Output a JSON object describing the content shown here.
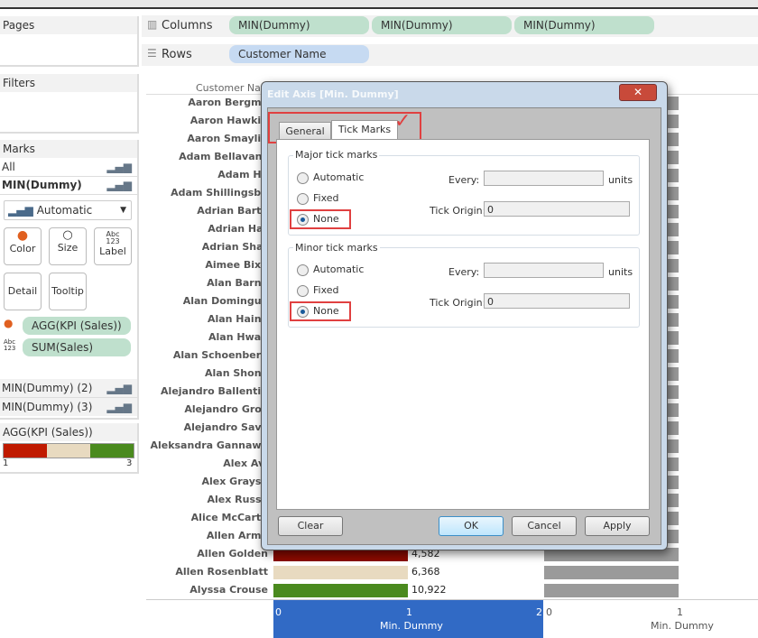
{
  "left_panel": {
    "pages": "Pages",
    "filters": "Filters",
    "marks": "Marks",
    "all": "All",
    "min_dummy": "MIN(Dummy)",
    "mark_type": "Automatic",
    "cards": [
      "Color",
      "Size",
      "Label",
      "Detail",
      "Tooltip"
    ],
    "label_icon_text": "Abc 123",
    "fields": [
      "AGG(KPI (Sales))",
      "SUM(Sales)"
    ],
    "min_dummy_2": "MIN(Dummy) (2)",
    "min_dummy_3": "MIN(Dummy) (3)",
    "legend": {
      "title": "AGG(KPI (Sales))",
      "min": "1",
      "max": "3",
      "colors": [
        "#c01a00",
        "#e8dac0",
        "#4a8a1e"
      ]
    }
  },
  "shelves": {
    "columns_label": "Columns",
    "columns": [
      "MIN(Dummy)",
      "MIN(Dummy)",
      "MIN(Dummy)"
    ],
    "rows_label": "Rows",
    "rows": [
      "Customer Name"
    ]
  },
  "view": {
    "header": "Customer Name",
    "customers": [
      "Aaron Bergma",
      "Aaron Hawkin",
      "Aaron Smaylin",
      "Adam Bellavanc",
      "Adam Ha",
      "Adam Shillingsbu",
      "Adrian Barto",
      "Adrian Har",
      "Adrian Shar",
      "Aimee Bixb",
      "Alan Barne",
      "Alan Domingue",
      "Alan Haine",
      "Alan Hwan",
      "Alan Schoenberg",
      "Alan Shone",
      "Alejandro Ballentin",
      "Alejandro Grov",
      "Alejandro Save",
      "Aleksandra Gannawa",
      "Alex Avi",
      "Alex Grayso",
      "Alex Russe",
      "Alice McCarth",
      "Allen Armo",
      "Allen Golden",
      "Allen Rosenblatt",
      "Alyssa Crouse"
    ],
    "visible_values": [
      {
        "index": 25,
        "value": "4,582",
        "color": "#8b0a00"
      },
      {
        "index": 26,
        "value": "6,368",
        "color": "#e8dac0"
      },
      {
        "index": 27,
        "value": "10,922",
        "color": "#4a8a1e"
      }
    ],
    "axis1": {
      "ticks": [
        "0",
        "1",
        "2"
      ],
      "title": "Min. Dummy"
    },
    "axis2": {
      "ticks": [
        "0",
        "1"
      ],
      "title": "Min. Dummy"
    }
  },
  "dialog": {
    "title": "Edit Axis [Min. Dummy]",
    "tabs": [
      "General",
      "Tick Marks"
    ],
    "active_tab": "Tick Marks",
    "major": {
      "legend": "Major tick marks",
      "options": [
        "Automatic",
        "Fixed",
        "None"
      ],
      "selected": "None",
      "every_label": "Every:",
      "every_value": "",
      "units": "units",
      "origin_label": "Tick Origin:",
      "origin_value": "0"
    },
    "minor": {
      "legend": "Minor tick marks",
      "options": [
        "Automatic",
        "Fixed",
        "None"
      ],
      "selected": "None",
      "every_label": "Every:",
      "every_value": "",
      "units": "units",
      "origin_label": "Tick Origin:",
      "origin_value": "0"
    },
    "buttons": {
      "clear": "Clear",
      "ok": "OK",
      "cancel": "Cancel",
      "apply": "Apply"
    }
  }
}
